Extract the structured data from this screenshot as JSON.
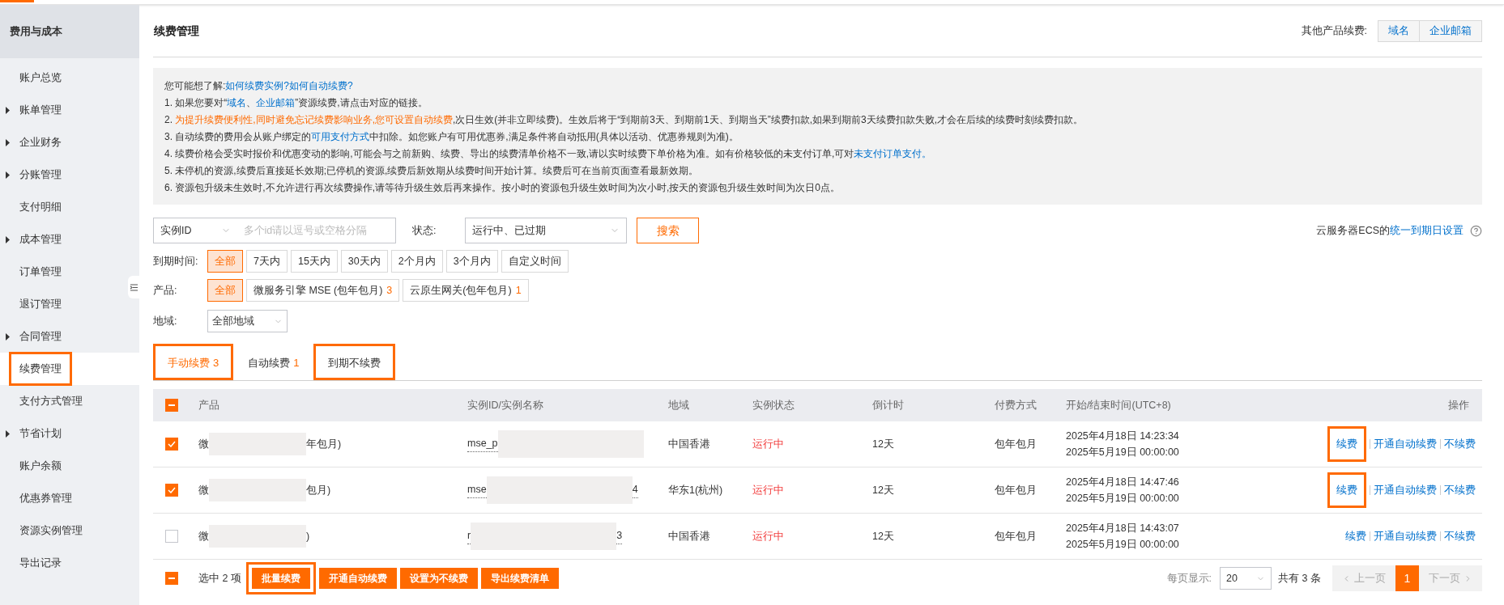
{
  "sidebar": {
    "title": "费用与成本",
    "items": [
      {
        "label": "账户总览",
        "kind": "link",
        "selected": false,
        "highlighted": false
      },
      {
        "label": "账单管理",
        "kind": "group",
        "selected": false,
        "highlighted": false
      },
      {
        "label": "企业财务",
        "kind": "group",
        "selected": false,
        "highlighted": false
      },
      {
        "label": "分账管理",
        "kind": "group",
        "selected": false,
        "highlighted": false
      },
      {
        "label": "支付明细",
        "kind": "link",
        "selected": false,
        "highlighted": false
      },
      {
        "label": "成本管理",
        "kind": "group",
        "selected": false,
        "highlighted": false
      },
      {
        "label": "订单管理",
        "kind": "link",
        "selected": false,
        "highlighted": false
      },
      {
        "label": "退订管理",
        "kind": "link",
        "selected": false,
        "highlighted": false
      },
      {
        "label": "合同管理",
        "kind": "group",
        "selected": false,
        "highlighted": false
      },
      {
        "label": "续费管理",
        "kind": "link",
        "selected": true,
        "highlighted": true
      },
      {
        "label": "支付方式管理",
        "kind": "link",
        "selected": false,
        "highlighted": false
      },
      {
        "label": "节省计划",
        "kind": "group",
        "selected": false,
        "highlighted": false
      },
      {
        "label": "账户余额",
        "kind": "link",
        "selected": false,
        "highlighted": false
      },
      {
        "label": "优惠券管理",
        "kind": "link",
        "selected": false,
        "highlighted": false
      },
      {
        "label": "资源实例管理",
        "kind": "link",
        "selected": false,
        "highlighted": false
      },
      {
        "label": "导出记录",
        "kind": "link",
        "selected": false,
        "highlighted": false
      }
    ]
  },
  "page_title": "续费管理",
  "other_products": {
    "label": "其他产品续费:",
    "links": [
      "域名",
      "企业邮箱"
    ]
  },
  "notice": [
    [
      {
        "kind": "text",
        "text": "您可能想了解:"
      },
      {
        "kind": "link",
        "text": "如何续费实例?"
      },
      {
        "kind": "link",
        "text": "如何自动续费?"
      }
    ],
    [
      {
        "kind": "text",
        "text": "1. 如果您要对“"
      },
      {
        "kind": "link",
        "text": "域名"
      },
      {
        "kind": "text",
        "text": "、"
      },
      {
        "kind": "link",
        "text": "企业邮箱"
      },
      {
        "kind": "text",
        "text": "”资源续费,请点击对应的链接。"
      }
    ],
    [
      {
        "kind": "text",
        "text": "2. "
      },
      {
        "kind": "warn",
        "text": "为提升续费便利性,同时避免忘记续费影响业务,您可设置自动续费"
      },
      {
        "kind": "text",
        "text": ",次日生效(并非立即续费)。生效后将于“到期前3天、到期前1天、到期当天”续费扣款,如果到期前3天续费扣款失败,才会在后续的续费时刻续费扣款。"
      }
    ],
    [
      {
        "kind": "text",
        "text": "3. 自动续费的费用会从账户绑定的"
      },
      {
        "kind": "link",
        "text": "可用支付方式"
      },
      {
        "kind": "text",
        "text": "中扣除。如您账户有可用优惠券,满足条件将自动抵用(具体以活动、优惠券规则为准)。"
      }
    ],
    [
      {
        "kind": "text",
        "text": "4. 续费价格会受实时报价和优惠变动的影响,可能会与之前新购、续费、导出的续费清单价格不一致,请以实时续费下单价格为准。如有价格较低的未支付订单,可对"
      },
      {
        "kind": "link",
        "text": "未支付订单支付。"
      }
    ],
    [
      {
        "kind": "text",
        "text": "5. 未停机的资源,续费后直接延长效期;已停机的资源,续费后新效期从续费时间开始计算。续费后可在当前页面查看最新效期。"
      }
    ],
    [
      {
        "kind": "text",
        "text": "6. 资源包升级未生效时,不允许进行再次续费操作,请等待升级生效后再来操作。按小时的资源包升级生效时间为次小时,按天的资源包升级生效时间为次日0点。"
      }
    ]
  ],
  "search": {
    "id_type": "实例ID",
    "placeholder": "多个id请以逗号或空格分隔",
    "status_label": "状态:",
    "status_value": "运行中、已过期",
    "button": "搜索"
  },
  "ecs_note": {
    "text": "云服务器ECS的",
    "link": "统一到期日设置"
  },
  "filters": [
    {
      "label": "到期时间:",
      "options": [
        {
          "text": "全部",
          "selected": true
        },
        {
          "text": "7天内",
          "selected": false
        },
        {
          "text": "15天内",
          "selected": false
        },
        {
          "text": "30天内",
          "selected": false
        },
        {
          "text": "2个月内",
          "selected": false
        },
        {
          "text": "3个月内",
          "selected": false
        },
        {
          "text": "自定义时间",
          "selected": false
        }
      ]
    },
    {
      "label": "产品:",
      "options": [
        {
          "text": "全部",
          "selected": true
        },
        {
          "text": "微服务引擎 MSE (包年包月)",
          "count": "3",
          "selected": false
        },
        {
          "text": "云原生网关(包年包月)",
          "count": "1",
          "selected": false
        }
      ]
    }
  ],
  "region": {
    "label": "地域:",
    "value": "全部地域"
  },
  "tabs": [
    {
      "label": "手动续费",
      "count": "3",
      "selected": true,
      "highlighted": true
    },
    {
      "label": "自动续费",
      "count": "1",
      "selected": false,
      "highlighted": false
    },
    {
      "label": "到期不续费",
      "selected": false,
      "highlighted": true
    }
  ],
  "table": {
    "header_checkbox": {
      "checked": true,
      "indeterminate": true
    },
    "columns": [
      "产品",
      "实例ID/实例名称",
      "地域",
      "实例状态",
      "倒计时",
      "付费方式",
      "开始/结束时间(UTC+8)",
      "操作"
    ],
    "rows": [
      {
        "checked": true,
        "product": {
          "prefix": "微",
          "suffix": "年包月)"
        },
        "instance": {
          "prefix": "mse_p"
        },
        "region": "中国香港",
        "status": "运行中",
        "countdown": "12天",
        "payment": "包年包月",
        "start": "2025年4月18日 14:23:34",
        "end": "2025年5月19日 00:00:00",
        "actions": [
          {
            "text": "续费",
            "highlighted": true
          },
          {
            "text": "开通自动续费",
            "highlighted": false
          },
          {
            "text": "不续费",
            "highlighted": false
          }
        ]
      },
      {
        "checked": true,
        "product": {
          "prefix": "微",
          "suffix": "包月)"
        },
        "instance": {
          "prefix": "mse",
          "suffix": "4"
        },
        "region": "华东1(杭州)",
        "status": "运行中",
        "countdown": "12天",
        "payment": "包年包月",
        "start": "2025年4月18日 14:47:46",
        "end": "2025年5月19日 00:00:00",
        "actions": [
          {
            "text": "续费",
            "highlighted": true
          },
          {
            "text": "开通自动续费",
            "highlighted": false
          },
          {
            "text": "不续费",
            "highlighted": false
          }
        ]
      },
      {
        "checked": false,
        "product": {
          "prefix": "微",
          "suffix": ")"
        },
        "instance": {
          "prefix": "r",
          "suffix": "3"
        },
        "region": "中国香港",
        "status": "运行中",
        "countdown": "12天",
        "payment": "包年包月",
        "start": "2025年4月18日 14:43:07",
        "end": "2025年5月19日 00:00:00",
        "actions": [
          {
            "text": "续费",
            "highlighted": false
          },
          {
            "text": "开通自动续费",
            "highlighted": false
          },
          {
            "text": "不续费",
            "highlighted": false
          }
        ]
      }
    ]
  },
  "footer": {
    "checkbox": {
      "checked": true,
      "indeterminate": true
    },
    "selected_text": "选中 2 项",
    "buttons": [
      {
        "text": "批量续费",
        "highlighted": true
      },
      {
        "text": "开通自动续费",
        "highlighted": false
      },
      {
        "text": "设置为不续费",
        "highlighted": false
      },
      {
        "text": "导出续费清单",
        "highlighted": false
      }
    ],
    "page_size_label": "每页显示:",
    "page_size": "20",
    "total": "共有 3 条",
    "pager": [
      {
        "kind": "prev",
        "text": "上一页",
        "disabled": true,
        "selected": false
      },
      {
        "kind": "page",
        "text": "1",
        "disabled": false,
        "selected": true
      },
      {
        "kind": "next",
        "text": "下一页",
        "disabled": true,
        "selected": false
      }
    ]
  }
}
